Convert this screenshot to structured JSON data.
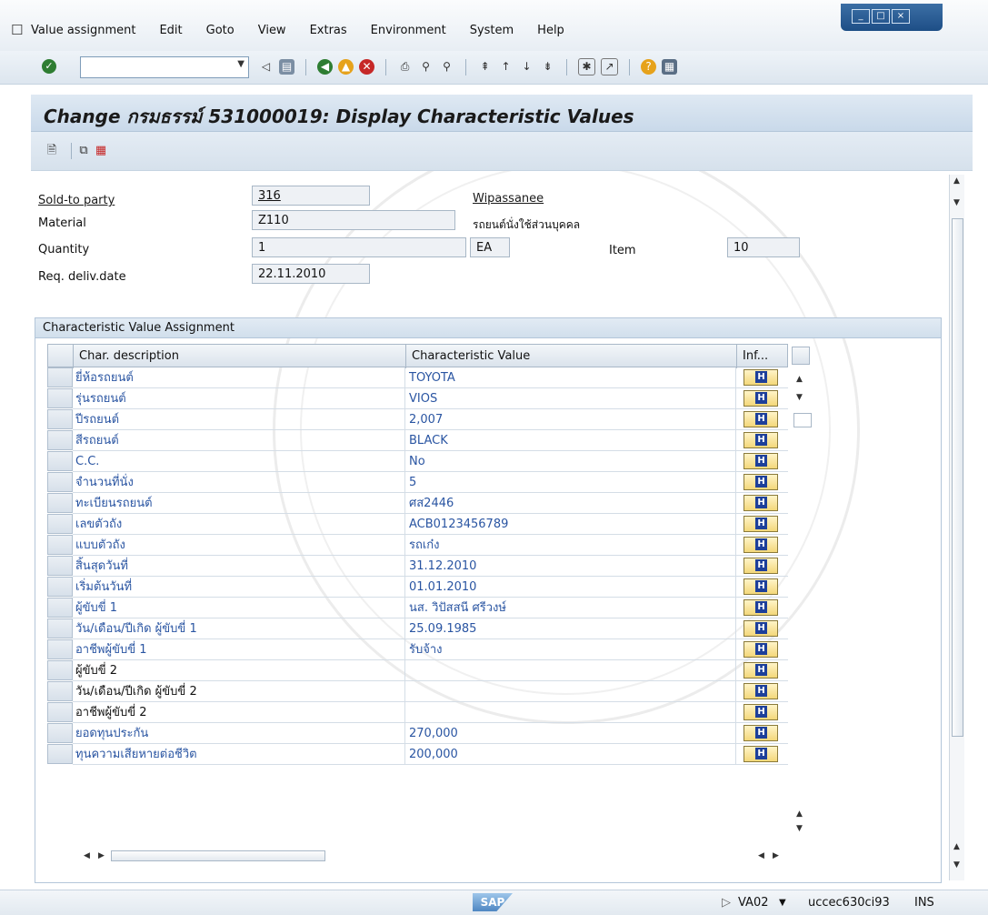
{
  "menu": [
    "Value assignment",
    "Edit",
    "Goto",
    "View",
    "Extras",
    "Environment",
    "System",
    "Help"
  ],
  "toolbar": {
    "command_value": ""
  },
  "page_title": "Change กรมธรรม์ 531000019: Display Characteristic Values",
  "header_fields": {
    "sold_to_label": "Sold-to party",
    "sold_to_value": "316",
    "sold_to_name": "Wipassanee",
    "material_label": "Material",
    "material_value": "Z110",
    "material_desc": "รถยนต์นั่งใช้ส่วนบุคคล",
    "quantity_label": "Quantity",
    "quantity_value": "1",
    "unit_value": "EA",
    "item_label": "Item",
    "item_value": "10",
    "req_deliv_label": "Req. deliv.date",
    "req_deliv_value": "22.11.2010"
  },
  "group_title": "Characteristic Value Assignment",
  "table": {
    "columns": [
      "Char. description",
      "Characteristic Value",
      "Inf..."
    ],
    "rows": [
      {
        "desc": "ยี่ห้อรถยนต์",
        "value": "TOYOTA"
      },
      {
        "desc": "รุ่นรถยนต์",
        "value": "VIOS"
      },
      {
        "desc": "ปีรถยนต์",
        "value": "2,007"
      },
      {
        "desc": "สีรถยนต์",
        "value": "BLACK"
      },
      {
        "desc": "C.C.",
        "value": "No"
      },
      {
        "desc": "จำนวนที่นั่ง",
        "value": "5"
      },
      {
        "desc": "ทะเบียนรถยนต์",
        "value": "ศส2446"
      },
      {
        "desc": "เลขตัวถัง",
        "value": "ACB0123456789"
      },
      {
        "desc": "แบบตัวถัง",
        "value": "รถเก๋ง"
      },
      {
        "desc": "สิ้นสุดวันที่",
        "value": "31.12.2010"
      },
      {
        "desc": "เริ่มต้นวันที่",
        "value": "01.01.2010"
      },
      {
        "desc": "ผู้ขับขี่ 1",
        "value": "นส. วิปัสสนี ศรีวงษ์"
      },
      {
        "desc": "วัน/เดือน/ปีเกิด ผู้ขับขี่ 1",
        "value": "25.09.1985"
      },
      {
        "desc": "อาชีพผู้ขับขี่ 1",
        "value": "รับจ้าง"
      },
      {
        "desc": "ผู้ขับขี่ 2",
        "value": ""
      },
      {
        "desc": "วัน/เดือน/ปีเกิด ผู้ขับขี่ 2",
        "value": ""
      },
      {
        "desc": "อาชีพผู้ขับขี่ 2",
        "value": ""
      },
      {
        "desc": "ยอดทุนประกัน",
        "value": "270,000"
      },
      {
        "desc": "ทุนความเสียหายต่อชีวิต",
        "value": "200,000"
      }
    ],
    "info_icon": "H"
  },
  "status": {
    "brand": "SAP",
    "transaction": "VA02",
    "server": "uccec630ci93",
    "mode": "INS"
  },
  "icons": {
    "enter": "check-icon",
    "save": "save-icon",
    "back": "back-icon",
    "exit": "exit-icon",
    "cancel": "cancel-icon",
    "print": "print-icon",
    "find": "find-icon",
    "help": "help-icon"
  }
}
